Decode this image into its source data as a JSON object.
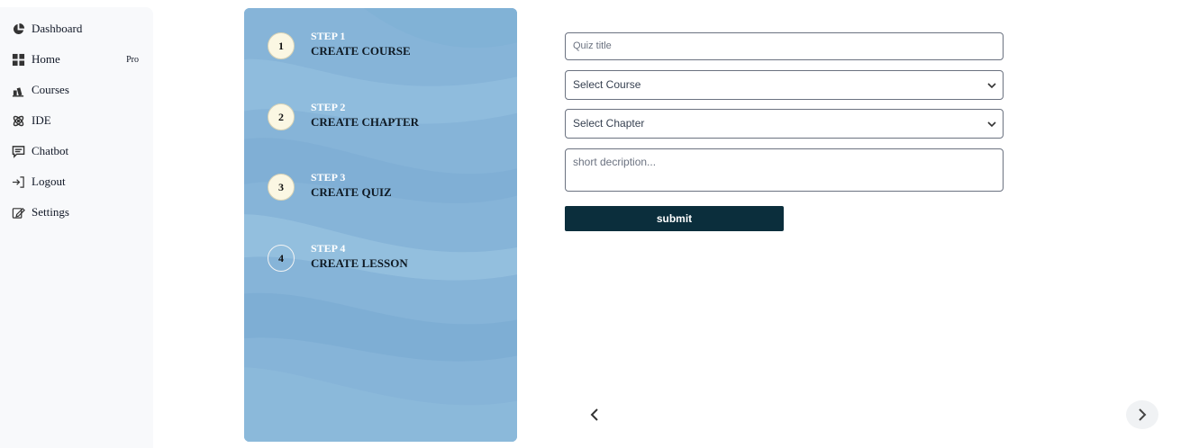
{
  "sidebar": {
    "items": [
      {
        "label": "Dashboard",
        "icon": "pie-chart-icon"
      },
      {
        "label": "Home",
        "icon": "grid-icon",
        "badge": "Pro"
      },
      {
        "label": "Courses",
        "icon": "courses-icon"
      },
      {
        "label": "IDE",
        "icon": "atom-icon"
      },
      {
        "label": "Chatbot",
        "icon": "chat-icon"
      },
      {
        "label": "Logout",
        "icon": "logout-icon"
      },
      {
        "label": "Settings",
        "icon": "settings-icon"
      }
    ]
  },
  "steps": [
    {
      "number": "1",
      "step": "STEP 1",
      "name": "CREATE COURSE",
      "done": true
    },
    {
      "number": "2",
      "step": "STEP 2",
      "name": "CREATE CHAPTER",
      "done": true
    },
    {
      "number": "3",
      "step": "STEP 3",
      "name": "CREATE QUIZ",
      "done": true
    },
    {
      "number": "4",
      "step": "STEP 4",
      "name": "CREATE LESSON",
      "done": false
    }
  ],
  "form": {
    "quiz_title_placeholder": "Quiz title",
    "course_select": "Select Course",
    "chapter_select": "Select Chapter",
    "description_placeholder": "short decription...",
    "submit_label": "submit"
  },
  "colors": {
    "panel": "#86b4d8",
    "submit": "#0b2e3c",
    "sidebar_bg": "#f8f9fb"
  }
}
